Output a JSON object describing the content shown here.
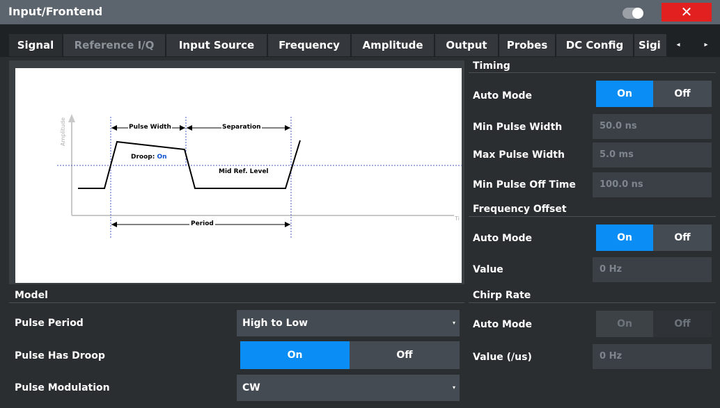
{
  "window": {
    "title": "Input/Frontend",
    "close_symbol": "✕"
  },
  "tabs": [
    {
      "label": "Signal"
    },
    {
      "label": "Reference I/Q"
    },
    {
      "label": "Input Source"
    },
    {
      "label": "Frequency"
    },
    {
      "label": "Amplitude"
    },
    {
      "label": "Output"
    },
    {
      "label": "Probes"
    },
    {
      "label": "DC Config"
    },
    {
      "label": "Sigi"
    }
  ],
  "tab_arrows": {
    "left": "◂",
    "right": "▸"
  },
  "diagram": {
    "y_axis_label": "Amplitude",
    "x_axis_label": "Ti",
    "pulse_width": "Pulse Width",
    "separation": "Separation",
    "droop_label": "Droop:",
    "droop_value": "On",
    "mid_ref_level": "Mid Ref. Level",
    "period": "Period"
  },
  "timing": {
    "title": "Timing",
    "auto_mode_label": "Auto Mode",
    "auto_on": "On",
    "auto_off": "Off",
    "min_pulse_width_label": "Min Pulse Width",
    "min_pulse_width_value": "50.0 ns",
    "max_pulse_width_label": "Max Pulse Width",
    "max_pulse_width_value": "5.0 ms",
    "min_pulse_off_label": "Min Pulse Off Time",
    "min_pulse_off_value": "100.0 ns"
  },
  "frequency_offset": {
    "title": "Frequency Offset",
    "auto_mode_label": "Auto Mode",
    "auto_on": "On",
    "auto_off": "Off",
    "value_label": "Value",
    "value": "0 Hz"
  },
  "model": {
    "title": "Model",
    "pulse_period_label": "Pulse Period",
    "pulse_period_value": "High to Low",
    "pulse_droop_label": "Pulse Has Droop",
    "droop_on": "On",
    "droop_off": "Off",
    "pulse_mod_label": "Pulse Modulation",
    "pulse_mod_value": "CW"
  },
  "chirp_rate": {
    "title": "Chirp Rate",
    "auto_mode_label": "Auto Mode",
    "auto_on": "On",
    "auto_off": "Off",
    "value_label": "Value (/us)",
    "value": "0 Hz"
  },
  "colors": {
    "accent": "#0a8df5",
    "close": "#e1201f",
    "titlebar": "#5c646d"
  }
}
